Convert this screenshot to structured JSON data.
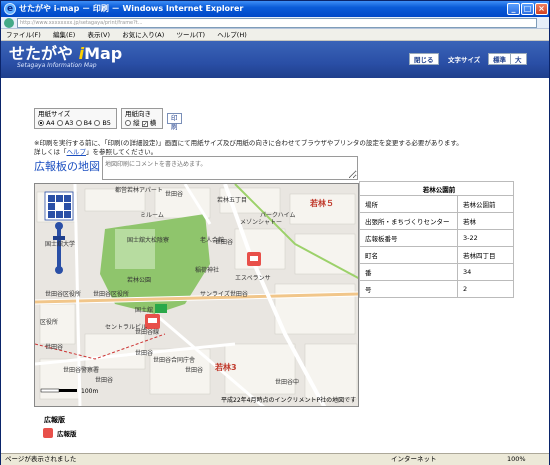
{
  "window": {
    "title": "せたがや i-map － 印刷 － Windows Internet Explorer",
    "url": "http://www.xxxxxxxx.jp/setagaya/print/frame?t..."
  },
  "menu": [
    "ファイル(F)",
    "編集(E)",
    "表示(V)",
    "お気に入り(A)",
    "ツール(T)",
    "ヘルプ(H)"
  ],
  "header": {
    "logo_main": "せたがや",
    "logo_i": "i",
    "logo_map": "Map",
    "logo_sub": "Setagaya Information Map",
    "close_label": "閉じる",
    "font_size_label": "文字サイズ",
    "std_label": "標準",
    "large_label": "大"
  },
  "options": {
    "paper_size_title": "用紙サイズ",
    "paper_sizes": [
      "A4",
      "A3",
      "B4",
      "B5"
    ],
    "orientation_title": "用紙向き",
    "orient_portrait": "縦",
    "orient_landscape": "横",
    "print_label": "印刷"
  },
  "note": {
    "line1": "※印刷を実行する前に、「印刷(の詳細設定)」画面にて用紙サイズ及び用紙の向きに合わせてブラウザやプリンタの設定を変更する必要があります。",
    "line2_pre": "詳しくは「",
    "line2_link": "ヘルプ",
    "line2_post": "」を参照してください。"
  },
  "map_title": "広報板の地図",
  "comment_placeholder": "地図印刷にコメントを書き込めます。",
  "map": {
    "labels": [
      "都営若林アパート",
      "世田谷",
      "ミルーム",
      "若林五丁目",
      "メゾンシャトー",
      "パークハイム",
      "老人会館",
      "国士舘大松陰寮",
      "国士舘大学",
      "若林公園",
      "世田谷区役所",
      "世田谷区役所",
      "区役所",
      "セントラルビル",
      "世田谷",
      "世田谷線",
      "世田谷",
      "世田谷",
      "世田谷合同庁舎",
      "世田谷",
      "エスペランサ",
      "稲荷神社",
      "サンライズ世田谷",
      "若林3",
      "若林５",
      "国土舘",
      "世田谷警察署",
      "世田谷",
      "世田谷中"
    ],
    "copyright": "平成22年4月時点のインクリメントP社の地図です",
    "scale_label": "100m"
  },
  "info": {
    "title": "若林公園前",
    "rows": [
      {
        "k": "場所",
        "v": "若林公園前"
      },
      {
        "k": "出張所・まちづくりセンター",
        "v": "若林"
      },
      {
        "k": "広報板番号",
        "v": "3-22"
      },
      {
        "k": "町名",
        "v": "若林四丁目"
      },
      {
        "k": "番",
        "v": "34"
      },
      {
        "k": "号",
        "v": "2"
      }
    ]
  },
  "legend": {
    "title": "広報版",
    "item": "広報版"
  },
  "status": {
    "left": "ページが表示されました",
    "zone": "インターネット",
    "zoom": "100%"
  },
  "colors": {
    "header_blue": "#2a4fa6",
    "link_blue": "#1a4ec0",
    "pin_red": "#e8504a",
    "park_green": "#8fc56c"
  }
}
